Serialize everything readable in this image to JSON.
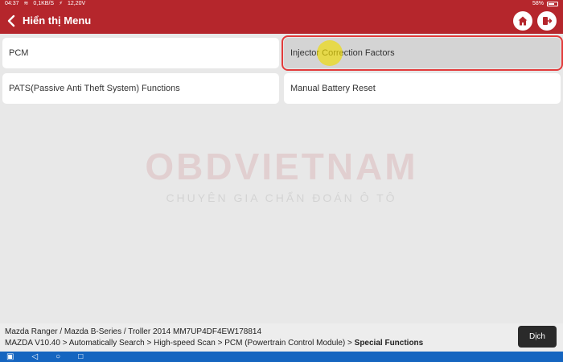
{
  "status_bar": {
    "time": "04:37",
    "speed": "0,1KB/S",
    "voltage": "12,20V",
    "battery": "58%"
  },
  "header": {
    "title": "Hiển thị Menu"
  },
  "menu": {
    "items": [
      {
        "label": "PCM",
        "selected": false
      },
      {
        "label": "Injector Correction Factors",
        "selected": true
      },
      {
        "label": "PATS(Passive Anti Theft System) Functions",
        "selected": false
      },
      {
        "label": "Manual Battery Reset",
        "selected": false
      }
    ]
  },
  "watermark": {
    "brand": "OBDVIETNAM",
    "tagline": "CHUYÊN GIA CHẨN ĐOÁN Ô TÔ"
  },
  "footer": {
    "vehicle": "Mazda  Ranger / Mazda B-Series / Troller 2014  MM7UP4DF4EW178814",
    "path_prefix": "MAZDA V10.40 > Automatically Search > High-speed Scan > PCM (Powertrain Control Module) > ",
    "path_current": "Special Functions",
    "translate_label": "Dịch"
  },
  "colors": {
    "brand_red": "#b5262c",
    "selection_outline": "#e23b3b",
    "nav_blue": "#1565c0"
  }
}
